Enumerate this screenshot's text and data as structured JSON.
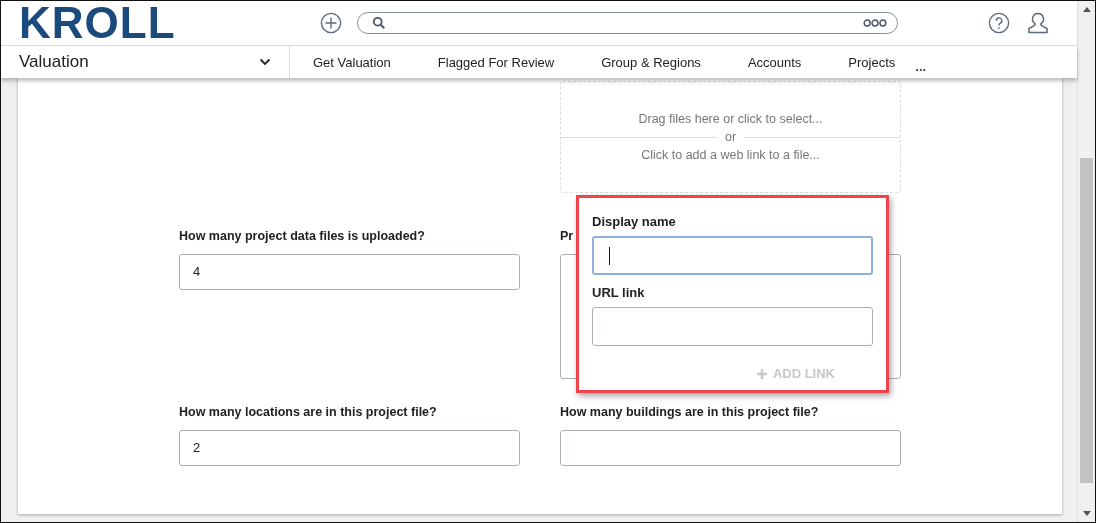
{
  "header": {
    "logo": "KROLL"
  },
  "nav": {
    "module": "Valuation",
    "tabs": [
      {
        "label": "Get Valuation"
      },
      {
        "label": "Flagged For Review"
      },
      {
        "label": "Group & Regions"
      },
      {
        "label": "Accounts"
      },
      {
        "label": "Projects"
      }
    ],
    "more": "..."
  },
  "upload": {
    "drop_text": "Drag files here or click to select...",
    "separator": "or",
    "link_text": "Click to add a web link to a file..."
  },
  "fields": [
    {
      "label": "How many project data files is uploaded?",
      "value": "4",
      "kind": "input"
    },
    {
      "label": "Pr",
      "kind": "textarea"
    },
    {
      "label": "How many locations are in this project file?",
      "value": "2",
      "kind": "input"
    },
    {
      "label": "How many buildings are in this project file?",
      "kind": "input"
    }
  ],
  "popup": {
    "display_name_label": "Display name",
    "url_label": "URL link",
    "add_button": "ADD LINK",
    "add_disabled": true
  }
}
